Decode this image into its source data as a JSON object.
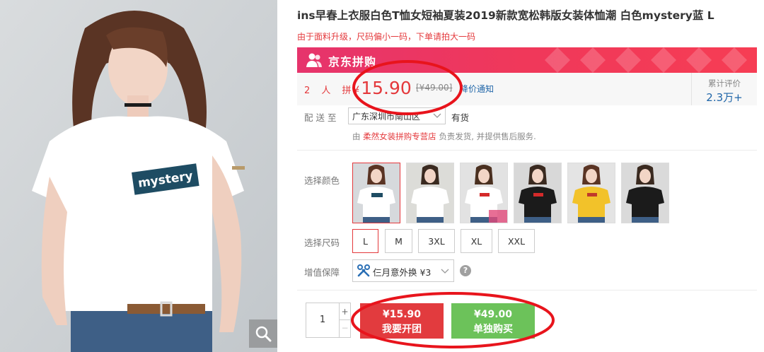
{
  "product": {
    "title": "ins早春上衣服白色T恤女短袖夏装2019新款宽松韩版女装体恤潮 白色mystery蓝 L",
    "subtitle": "由于面料升级，尺码偏小一码，下单请拍大一码",
    "image_text": "mystery"
  },
  "banner": {
    "label": "京东拼购",
    "icon": "people-icon"
  },
  "price": {
    "group_count": "2 人 拼",
    "currency": "¥",
    "current": "15.90",
    "original": "[¥49.00]",
    "notice": "降价通知"
  },
  "reviews": {
    "label": "累计评价",
    "value": "2.3万+"
  },
  "delivery": {
    "label": "配 送 至",
    "location": "广东深圳市南山区",
    "stock": "有货",
    "shop_prefix": "由",
    "shop_name": "柔然女装拼购专营店",
    "shop_suffix": "负责发货, 并提供售后服务."
  },
  "colors": {
    "label": "选择颜色",
    "options": [
      "white-mystery",
      "white-plain",
      "white-red",
      "black-red",
      "yellow",
      "black"
    ]
  },
  "sizes": {
    "label": "选择尺码",
    "options": [
      "L",
      "M",
      "3XL",
      "XL",
      "XXL"
    ],
    "selected": "L"
  },
  "service": {
    "label": "增值保障",
    "option": "仨月意外换 ¥3",
    "help": "?"
  },
  "quantity": {
    "value": "1",
    "plus": "+",
    "minus": "−"
  },
  "buttons": {
    "group_price": "¥15.90",
    "group_label": "我要开团",
    "single_price": "¥49.00",
    "single_label": "单独购买"
  },
  "colors_hex": {
    "accent_red": "#e4393c",
    "banner_pink": "#f0385a",
    "link_blue": "#1f65a8",
    "buy_green": "#6cc25a"
  }
}
